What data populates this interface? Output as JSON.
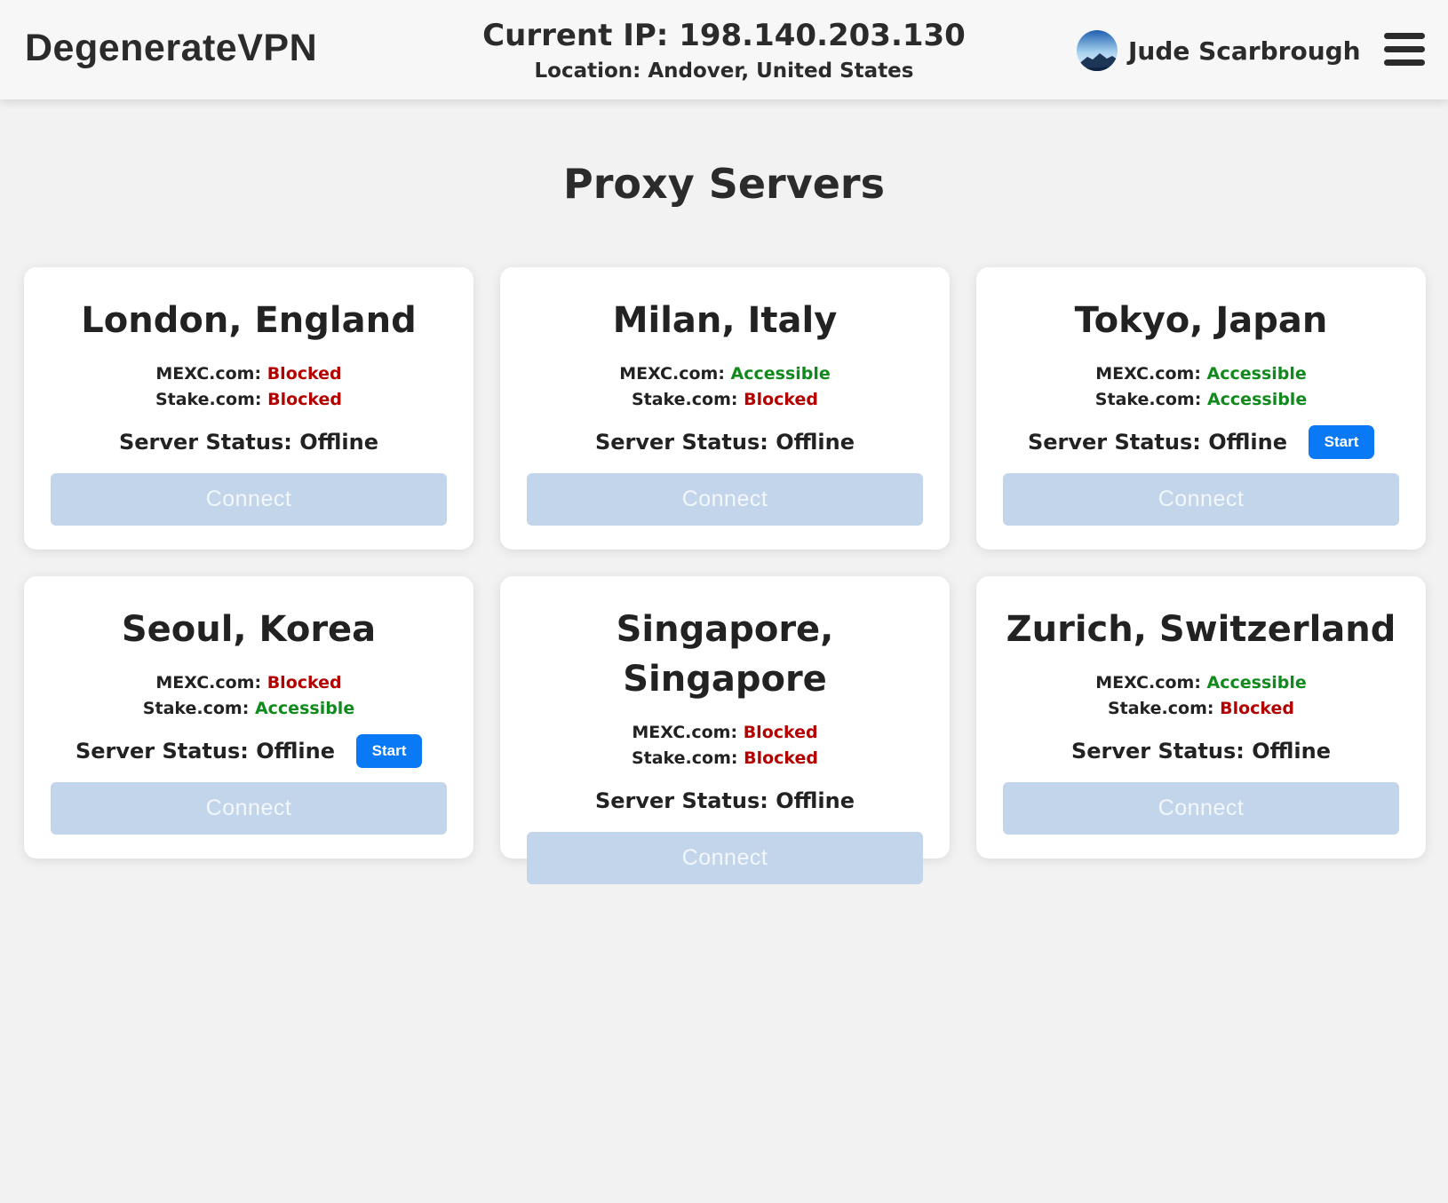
{
  "header": {
    "brand": "DegenerateVPN",
    "ip_line": "Current IP: 198.140.203.130",
    "location_line": "Location: Andover, United States",
    "user_name": "Jude Scarbrough",
    "avatar_icon": "mountain-avatar-icon",
    "menu_icon": "hamburger-menu-icon"
  },
  "page": {
    "title": "Proxy Servers"
  },
  "labels": {
    "mexc": "MEXC.com:",
    "stake": "Stake.com:",
    "status": "Server Status: Offline",
    "start": "Start",
    "connect": "Connect"
  },
  "colors": {
    "blocked": "#b50000",
    "accessible": "#118a1d",
    "start_button": "#0a79f5",
    "connect_disabled": "#c3d5ea"
  },
  "servers": [
    {
      "name": "London, England",
      "mexc": "Blocked",
      "stake": "Blocked",
      "show_start": false
    },
    {
      "name": "Milan, Italy",
      "mexc": "Accessible",
      "stake": "Blocked",
      "show_start": false
    },
    {
      "name": "Tokyo, Japan",
      "mexc": "Accessible",
      "stake": "Accessible",
      "show_start": true
    },
    {
      "name": "Seoul, Korea",
      "mexc": "Blocked",
      "stake": "Accessible",
      "show_start": true
    },
    {
      "name": "Singapore, Singapore",
      "mexc": "Blocked",
      "stake": "Blocked",
      "show_start": false
    },
    {
      "name": "Zurich, Switzerland",
      "mexc": "Accessible",
      "stake": "Blocked",
      "show_start": false
    }
  ]
}
